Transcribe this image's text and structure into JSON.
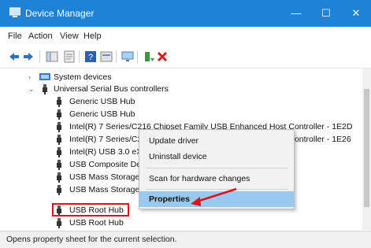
{
  "window": {
    "title": "Device Manager",
    "controls": [
      "—",
      "☐",
      "✕"
    ]
  },
  "menu": [
    "File",
    "Action",
    "View",
    "Help"
  ],
  "toolbar": {
    "icons": [
      "back-icon",
      "forward-icon",
      "console-tree-icon",
      "properties-icon",
      "help-icon",
      "device-view-icon",
      "monitor-icon",
      "update-driver-icon",
      "uninstall-icon"
    ]
  },
  "tree": {
    "collapsed_category": "System devices",
    "expanded_category": "Universal Serial Bus controllers",
    "devices": [
      "Generic USB Hub",
      "Generic USB Hub",
      "Intel(R) 7 Series/C216 Chipset Family USB Enhanced Host Controller - 1E2D",
      "Intel(R) 7 Series/C216 Chipset Family USB Enhanced Host Controller - 1E26",
      "Intel(R) USB 3.0 eXtensible Host Controller",
      "USB Composite Device",
      "USB Mass Storage Device",
      "USB Mass Storage Device",
      "USB Root Hub",
      "USB Root Hub"
    ]
  },
  "context_menu": {
    "items": [
      "Update driver",
      "Uninstall device",
      "Scan for hardware changes",
      "Properties"
    ],
    "highlighted": "Properties"
  },
  "status_bar": "Opens property sheet for the current selection.",
  "colors": {
    "titlebar": "#1e82d6",
    "highlight": "#99c9ef",
    "annotation": "#e0101a"
  }
}
